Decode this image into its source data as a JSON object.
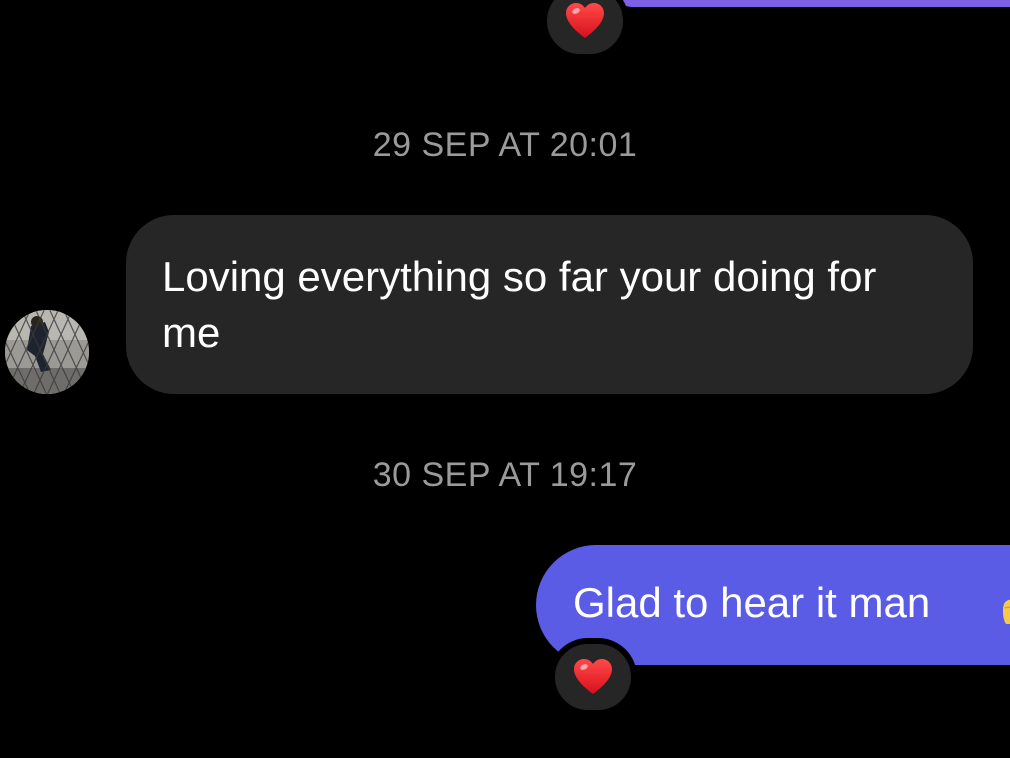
{
  "conversation": {
    "timestamps": [
      "29 SEP AT 20:01",
      "30 SEP AT 19:17"
    ],
    "messages": [
      {
        "direction": "incoming",
        "text": "Loving everything so far your doing for me"
      },
      {
        "direction": "outgoing",
        "text": "Glad to hear it man"
      }
    ],
    "reactions": [
      {
        "icon": "heart-icon",
        "emoji": "❤️"
      },
      {
        "icon": "heart-icon",
        "emoji": "❤️"
      }
    ],
    "colors": {
      "background": "#000000",
      "incoming_bubble": "#262626",
      "outgoing_bubble": "#5a5ce6",
      "timestamp_text": "#9a9a9a"
    }
  }
}
